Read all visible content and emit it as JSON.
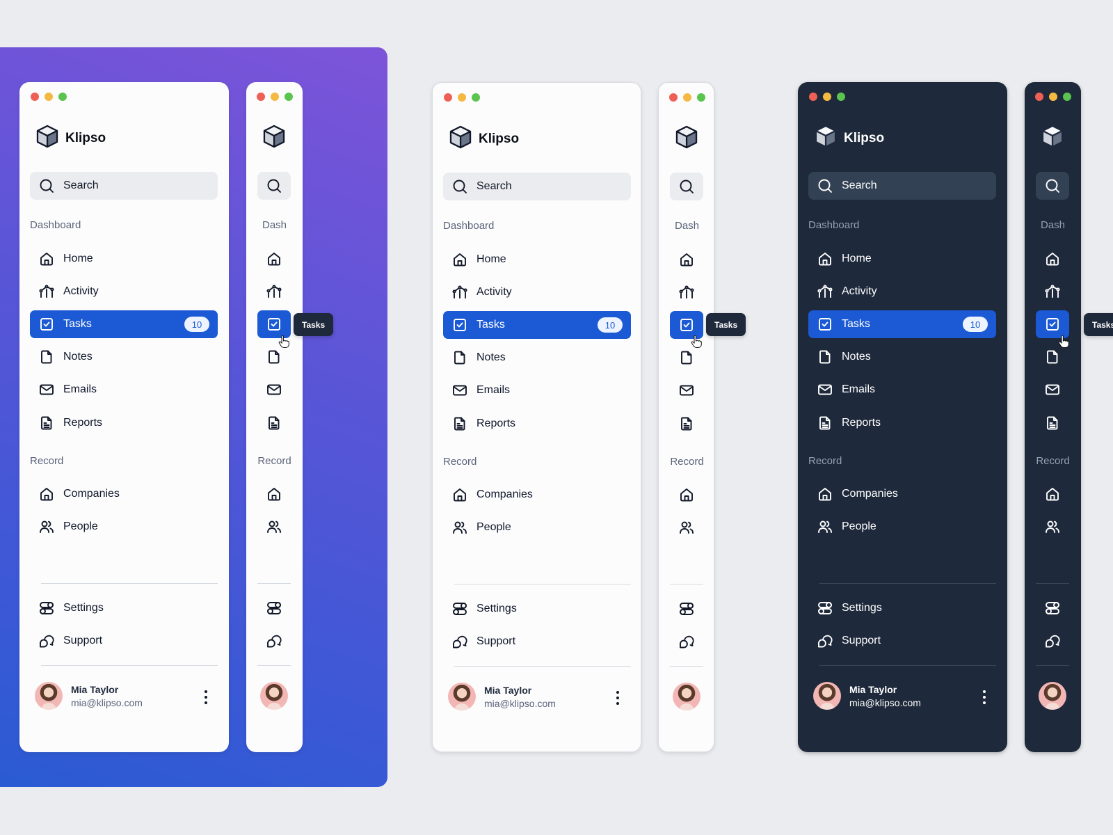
{
  "app": {
    "name": "Klipso"
  },
  "search": {
    "placeholder": "Search"
  },
  "sections": {
    "dashboard": {
      "label": "Dashboard",
      "short_label": "Dash"
    },
    "record": {
      "label": "Record",
      "short_label": "Record"
    }
  },
  "nav": {
    "home": {
      "label": "Home",
      "icon": "home-icon"
    },
    "activity": {
      "label": "Activity",
      "icon": "activity-icon"
    },
    "tasks": {
      "label": "Tasks",
      "icon": "checkbox-icon",
      "badge": "10",
      "active": true
    },
    "notes": {
      "label": "Notes",
      "icon": "file-icon"
    },
    "emails": {
      "label": "Emails",
      "icon": "mail-icon"
    },
    "reports": {
      "label": "Reports",
      "icon": "document-icon"
    },
    "companies": {
      "label": "Companies",
      "icon": "building-icon"
    },
    "people": {
      "label": "People",
      "icon": "users-icon"
    },
    "settings": {
      "label": "Settings",
      "icon": "toggles-icon"
    },
    "support": {
      "label": "Support",
      "icon": "chat-bubbles-icon"
    }
  },
  "user": {
    "name": "Mia Taylor",
    "email": "mia@klipso.com"
  },
  "tooltip": {
    "label": "Tasks"
  },
  "colors": {
    "accent": "#1b5ad4",
    "dark_panel": "#1e293b",
    "light_panel": "#fcfcfd",
    "backdrop_gradient": [
      "#7d54d9",
      "#2a5bd3"
    ],
    "traffic_lights": [
      "#ee6056",
      "#f4b942",
      "#5bc44f"
    ]
  }
}
